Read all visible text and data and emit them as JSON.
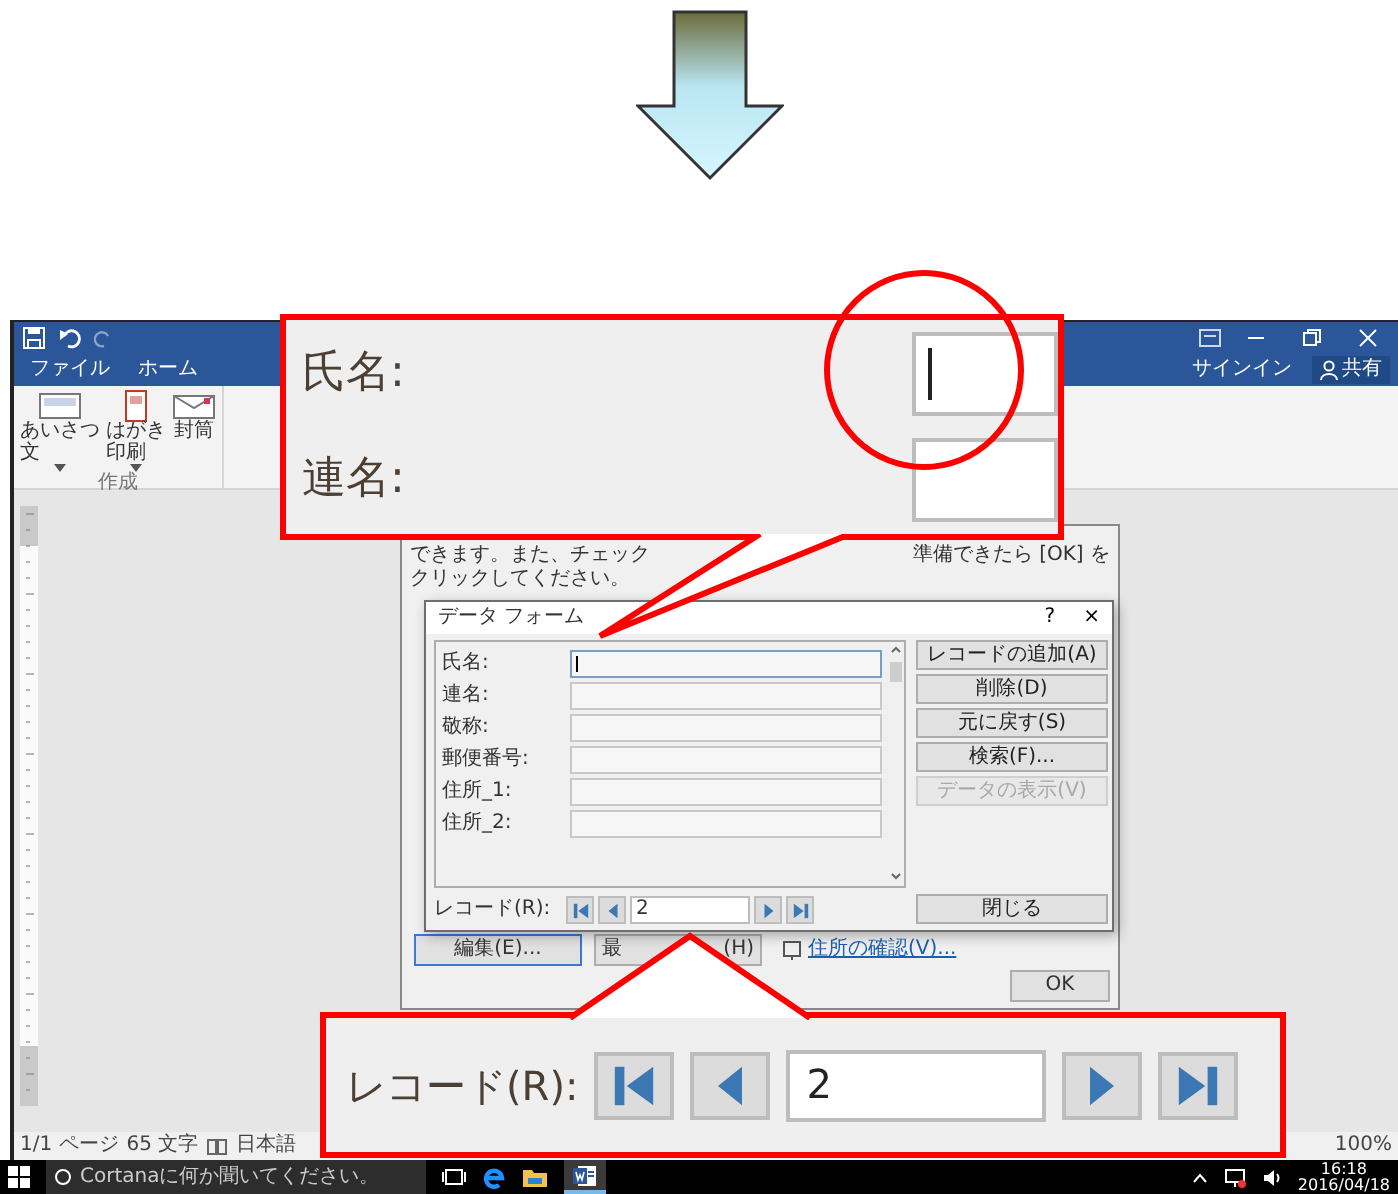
{
  "title_bar": {
    "tabs": [
      "ファイル",
      "ホーム"
    ],
    "sign_in": "サインイン",
    "share": "共有"
  },
  "ribbon": {
    "buttons": [
      {
        "lines": [
          "あいさつ",
          "文"
        ],
        "dropdown": true
      },
      {
        "lines": [
          "はがき",
          "印刷"
        ],
        "dropdown": true
      },
      {
        "lines": [
          "封筒"
        ],
        "dropdown": false
      }
    ],
    "group_label": "作成"
  },
  "merge_dialog": {
    "intro_line_1_left": "できます。また、チェック",
    "intro_line_1_right": "準備できたら [OK] を",
    "intro_line_2": "クリックしてください。",
    "edit_button": "編集(E)...",
    "partial_button_left": "最",
    "partial_button_right": "(H)",
    "link": "住所の確認(V)...",
    "ok_button": "OK"
  },
  "data_form": {
    "title": "データ フォーム",
    "help": "?",
    "close": "×",
    "fields": [
      {
        "label": "氏名:",
        "focused": true
      },
      {
        "label": "連名:",
        "focused": false
      },
      {
        "label": "敬称:",
        "focused": false
      },
      {
        "label": "郵便番号:",
        "focused": false
      },
      {
        "label": "住所_1:",
        "focused": false
      },
      {
        "label": "住所_2:",
        "focused": false
      }
    ],
    "buttons": [
      {
        "label": "レコードの追加(A)",
        "disabled": false
      },
      {
        "label": "削除(D)",
        "disabled": false
      },
      {
        "label": "元に戻す(S)",
        "disabled": false
      },
      {
        "label": "検索(F)...",
        "disabled": false
      },
      {
        "label": "データの表示(V)",
        "disabled": true
      }
    ],
    "record_label": "レコード(R):",
    "record": "2",
    "close_button": "閉じる"
  },
  "status_bar": {
    "items": [
      "1/1 ページ",
      "65 文字",
      "日本語"
    ],
    "zoom": "100%"
  },
  "taskbar": {
    "search_placeholder": "Cortanaに何か聞いてください。",
    "time": "16:18",
    "date": "2016/04/18"
  },
  "callout_fields": {
    "fields": [
      {
        "label": "氏名:",
        "focused": true
      },
      {
        "label": "連名:",
        "focused": false
      }
    ]
  },
  "callout_record": {
    "label": "レコード(R):",
    "record": "2"
  }
}
